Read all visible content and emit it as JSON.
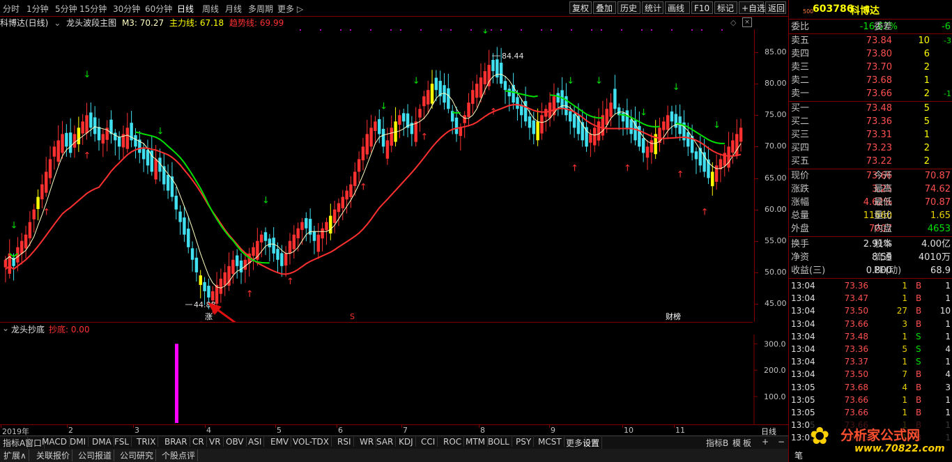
{
  "toolbar": {
    "periods": [
      "分时",
      "1分钟",
      "5分钟",
      "15分钟",
      "30分钟",
      "60分钟",
      "日线",
      "周线",
      "月线",
      "多周期",
      "更多"
    ],
    "active_period": "日线",
    "buttons": [
      "复权",
      "叠加",
      "历史",
      "统计",
      "画线",
      "F10",
      "标记",
      "+自选",
      "返回"
    ]
  },
  "chart_header": {
    "stock_label": "科博达(日线)",
    "formula": "龙头波段主图",
    "m3": "M3: 70.27",
    "main_line": "主力线: 67.18",
    "trend_line": "趋势线: 69.99"
  },
  "annotations": {
    "high_label": "84.44",
    "low_label": "44.88",
    "marker_zhang": "涨",
    "marker_s": "S",
    "marker_caibang": "财榜"
  },
  "sub_header": {
    "name": "龙头抄底",
    "value_label": "抄底: 0.00"
  },
  "x_axis": {
    "labels": [
      "2019年",
      "2",
      "3",
      "4",
      "5",
      "6",
      "7",
      "8",
      "9",
      "10",
      "11"
    ],
    "right_label": "日线"
  },
  "indicator_tabs": [
    "指标A",
    "窗口",
    "MACD",
    "DMI",
    "DMA",
    "FSL",
    "TRIX",
    "BRAR",
    "CR",
    "VR",
    "OBV",
    "ASI",
    "EMV",
    "VOL-TDX",
    "RSI",
    "WR",
    "SAR",
    "KDJ",
    "CCI",
    "ROC",
    "MTM",
    "BOLL",
    "PSY",
    "MCST",
    "更多",
    "设置"
  ],
  "indicator_right": [
    "指标B",
    "模",
    "板",
    "+",
    "−"
  ],
  "bottom_tabs": [
    "扩展∧",
    "关联报价",
    "公司报道",
    "公司研究",
    "个股点评"
  ],
  "colors": {
    "up": "#ff3030",
    "down": "#40e0f0",
    "border": "#800000",
    "main_line": "#ff3030",
    "trend_line": "#00e000",
    "m3_line": "#ffffc0",
    "signal_bar": "#ffff00",
    "chaodi_bar": "#ff00ff"
  },
  "chart_data": [
    {
      "type": "candlestick",
      "title": "龙头波段主图",
      "y_ticks": [
        "85.00",
        "80.00",
        "75.00",
        "70.00",
        "65.00",
        "60.00",
        "55.00",
        "50.00",
        "45.00"
      ],
      "ylim": [
        43,
        88
      ],
      "x_labels": [
        "2019年",
        "2",
        "3",
        "4",
        "5",
        "6",
        "7",
        "8",
        "9",
        "10",
        "11"
      ],
      "close_series": [
        52,
        53,
        51,
        54,
        55,
        56,
        58,
        60,
        62,
        64,
        66,
        68,
        70,
        71,
        72,
        70,
        69,
        72,
        73,
        74,
        75,
        73,
        72,
        71,
        72,
        73,
        72,
        71,
        70,
        72,
        73,
        71,
        70,
        69,
        68,
        67,
        66,
        68,
        66,
        64,
        63,
        62,
        60,
        58,
        56,
        54,
        52,
        50,
        48,
        47,
        46,
        47,
        48,
        49,
        50,
        51,
        52,
        51,
        50,
        52,
        53,
        54,
        55,
        56,
        55,
        54,
        53,
        52,
        51,
        53,
        55,
        56,
        57,
        58,
        57,
        56,
        55,
        56,
        57,
        58,
        59,
        60,
        61,
        62,
        63,
        64,
        66,
        68,
        70,
        72,
        73,
        74,
        72,
        70,
        71,
        73,
        74,
        75,
        74,
        73,
        72,
        74,
        76,
        78,
        79,
        80,
        79,
        78,
        77,
        76,
        74,
        72,
        73,
        75,
        77,
        79,
        80,
        81,
        82,
        83,
        82,
        81,
        80,
        79,
        78,
        77,
        76,
        75,
        74,
        73,
        72,
        74,
        75,
        76,
        77,
        78,
        77,
        76,
        75,
        74,
        73,
        72,
        71,
        70,
        72,
        73,
        74,
        75,
        76,
        77,
        76,
        75,
        74,
        73,
        72,
        71,
        70,
        69,
        70,
        71,
        72,
        73,
        74,
        75,
        74,
        73,
        72,
        71,
        70,
        69,
        68,
        67,
        66,
        65,
        66,
        67,
        68,
        69,
        70,
        71,
        72,
        73
      ],
      "high_label": "84.44",
      "low_label": "44.88",
      "current_value": 73.66,
      "lines": [
        "M3",
        "主力线",
        "趋势线"
      ]
    },
    {
      "type": "bar",
      "title": "龙头抄底",
      "y_ticks": [
        "300.0",
        "200.0",
        "100.0"
      ],
      "ylim": [
        0,
        330
      ],
      "values": [
        300
      ],
      "value_label": "抄底: 0.00"
    }
  ],
  "quote_panel": {
    "code": "603786",
    "name": "科博达",
    "small_label": "500",
    "weibi_label": "委比",
    "weibi_value": "-16.67%",
    "weicha_label": "委差",
    "weicha_value": "-6",
    "asks": [
      {
        "label": "卖五",
        "price": "73.84",
        "vol": "10",
        "chg": "-3"
      },
      {
        "label": "卖四",
        "price": "73.80",
        "vol": "6",
        "chg": ""
      },
      {
        "label": "卖三",
        "price": "73.70",
        "vol": "2",
        "chg": ""
      },
      {
        "label": "卖二",
        "price": "73.68",
        "vol": "1",
        "chg": ""
      },
      {
        "label": "卖一",
        "price": "73.66",
        "vol": "2",
        "chg": "-1"
      }
    ],
    "bids": [
      {
        "label": "买一",
        "price": "73.48",
        "vol": "5",
        "chg": ""
      },
      {
        "label": "买二",
        "price": "73.36",
        "vol": "5",
        "chg": ""
      },
      {
        "label": "买三",
        "price": "73.31",
        "vol": "1",
        "chg": ""
      },
      {
        "label": "买四",
        "price": "73.23",
        "vol": "2",
        "chg": ""
      },
      {
        "label": "买五",
        "price": "73.22",
        "vol": "2",
        "chg": ""
      }
    ],
    "stats1": [
      {
        "l1": "现价",
        "v1": "73.66",
        "l2": "今开",
        "v2": "70.87"
      },
      {
        "l1": "涨跌",
        "v1": "3.25",
        "l2": "最高",
        "v2": "74.62"
      },
      {
        "l1": "涨幅",
        "v1": "4.62%",
        "l2": "最低",
        "v2": "70.87"
      },
      {
        "l1": "总量",
        "v1": "11660",
        "l2": "量比",
        "v2": "1.65"
      },
      {
        "l1": "外盘",
        "v1": "7007",
        "l2": "内盘",
        "v2": "4653"
      }
    ],
    "stats2": [
      {
        "l1": "换手",
        "v1": "2.91%",
        "l2": "股本",
        "v2": "4.00亿"
      },
      {
        "l1": "净资",
        "v1": "8.59",
        "l2": "流通",
        "v2": "4010万"
      },
      {
        "l1": "收益(三)",
        "v1": "0.800",
        "l2": "PE(动)",
        "v2": "68.9"
      }
    ],
    "ticks": [
      {
        "time": "13:04",
        "price": "73.36",
        "vol": "1",
        "side": "B",
        "n": "1"
      },
      {
        "time": "13:04",
        "price": "73.47",
        "vol": "1",
        "side": "B",
        "n": "1"
      },
      {
        "time": "13:04",
        "price": "73.50",
        "vol": "27",
        "side": "B",
        "n": "10"
      },
      {
        "time": "13:04",
        "price": "73.66",
        "vol": "3",
        "side": "B",
        "n": "1"
      },
      {
        "time": "13:04",
        "price": "73.48",
        "vol": "1",
        "side": "S",
        "n": "1"
      },
      {
        "time": "13:04",
        "price": "73.36",
        "vol": "5",
        "side": "S",
        "n": "4"
      },
      {
        "time": "13:04",
        "price": "73.37",
        "vol": "1",
        "side": "S",
        "n": "1"
      },
      {
        "time": "13:04",
        "price": "73.50",
        "vol": "7",
        "side": "B",
        "n": "4"
      },
      {
        "time": "13:05",
        "price": "73.68",
        "vol": "4",
        "side": "B",
        "n": "3"
      },
      {
        "time": "13:05",
        "price": "73.66",
        "vol": "1",
        "side": "B",
        "n": "1"
      },
      {
        "time": "13:05",
        "price": "73.66",
        "vol": "1",
        "side": "B",
        "n": "1"
      },
      {
        "time": "13:05",
        "price": "73.66",
        "vol": "1",
        "side": "B",
        "n": "1"
      },
      {
        "time": "13:05",
        "price": "73.66",
        "vol": "1",
        "side": "B",
        "n": "1"
      }
    ],
    "bottom_label": "笔",
    "watermark": "分析家公式网",
    "watermark_url": "www.70822.com"
  }
}
